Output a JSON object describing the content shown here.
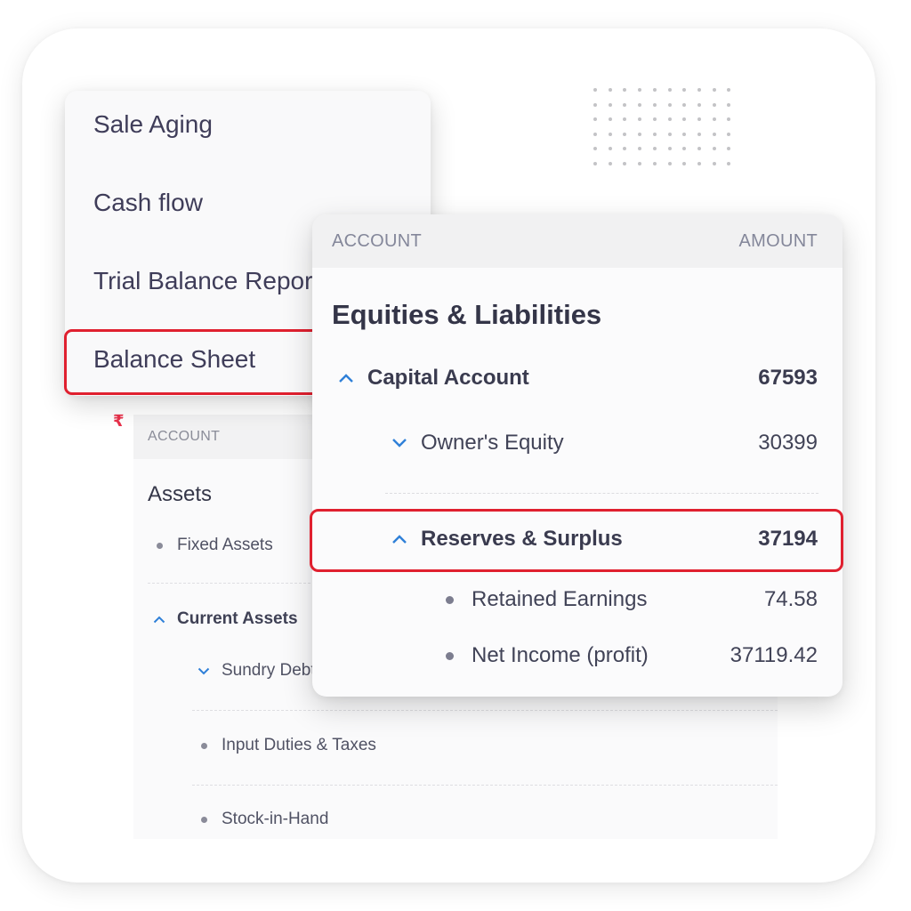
{
  "colors": {
    "accent_blue": "#2f80d8",
    "highlight_red": "#e0202f",
    "rupee_red": "#e8304a",
    "text_dark": "#3d3f55"
  },
  "menu": {
    "items": [
      {
        "label": "Sale Aging"
      },
      {
        "label": "Cash flow"
      },
      {
        "label": "Trial Balance Report"
      },
      {
        "label": "Balance Sheet",
        "highlighted": true
      }
    ]
  },
  "back_panel": {
    "currency_symbol": "₹",
    "header": {
      "account": "ACCOUNT"
    },
    "section_title": "Assets",
    "rows": [
      {
        "label": "Fixed Assets",
        "marker": "bullet"
      },
      {
        "label": "Current Assets",
        "marker": "chevron-up"
      },
      {
        "label": "Sundry Debtors",
        "marker": "chevron-down"
      },
      {
        "label": "Input Duties & Taxes",
        "marker": "bullet"
      },
      {
        "label": "Stock-in-Hand",
        "marker": "bullet"
      }
    ]
  },
  "detail_card": {
    "header": {
      "account": "ACCOUNT",
      "amount": "AMOUNT"
    },
    "section_title": "Equities & Liabilities",
    "rows": [
      {
        "label": "Capital Account",
        "amount": "67593",
        "marker": "chevron-up"
      },
      {
        "label": "Owner's Equity",
        "amount": "30399",
        "marker": "chevron-down"
      },
      {
        "label": "Reserves & Surplus",
        "amount": "37194",
        "marker": "chevron-up",
        "highlighted": true
      },
      {
        "label": "Retained Earnings",
        "amount": "74.58",
        "marker": "bullet"
      },
      {
        "label": "Net Income (profit)",
        "amount": "37119.42",
        "marker": "bullet"
      }
    ]
  }
}
